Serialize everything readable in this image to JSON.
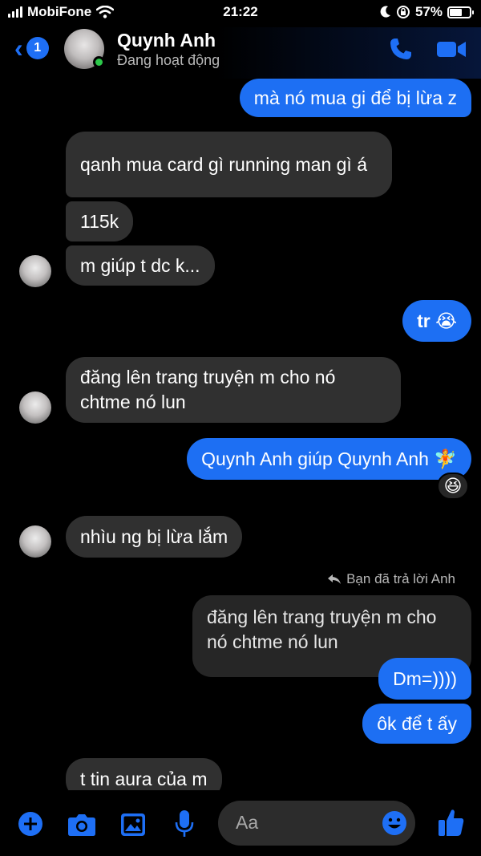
{
  "status_bar": {
    "carrier": "MobiFone",
    "time": "21:22",
    "battery": "57%",
    "battery_level": 0.57
  },
  "header": {
    "back_badge": "1",
    "contact_name": "Quynh Anh",
    "contact_status": "Đang hoạt động",
    "accent": "#1e6ff5",
    "online_color": "#2cc84a"
  },
  "messages": [
    {
      "side": "out",
      "text": "mà nó mua gi để bị lừa z"
    },
    {
      "side": "in",
      "text": "qanh mua card gì running man gì á"
    },
    {
      "side": "in",
      "text": "115k"
    },
    {
      "side": "in",
      "text": "m giúp t dc k..."
    },
    {
      "side": "out",
      "text": "tr 😭"
    },
    {
      "side": "in",
      "text": "đăng lên trang truyện m cho nó chtme nó lun"
    },
    {
      "side": "out",
      "text": "Quynh Anh giúp Quynh Anh 🧚",
      "reaction": "😆"
    },
    {
      "side": "in",
      "text": "nhìu ng bị lừa lắm"
    },
    {
      "side": "out",
      "text": "Dm=))))"
    },
    {
      "side": "out",
      "text": "ôk để t ấy"
    },
    {
      "side": "in",
      "text": "t tin aura của m"
    }
  ],
  "reply": {
    "note": "Bạn đã trả lời Anh",
    "quoted_text": "đăng lên trang truyện m cho nó chtme nó lun"
  },
  "composer": {
    "placeholder": "Aa",
    "icons": [
      "plus-icon",
      "camera-icon",
      "image-icon",
      "microphone-icon",
      "emoji-icon",
      "thumbs-up-icon"
    ]
  }
}
